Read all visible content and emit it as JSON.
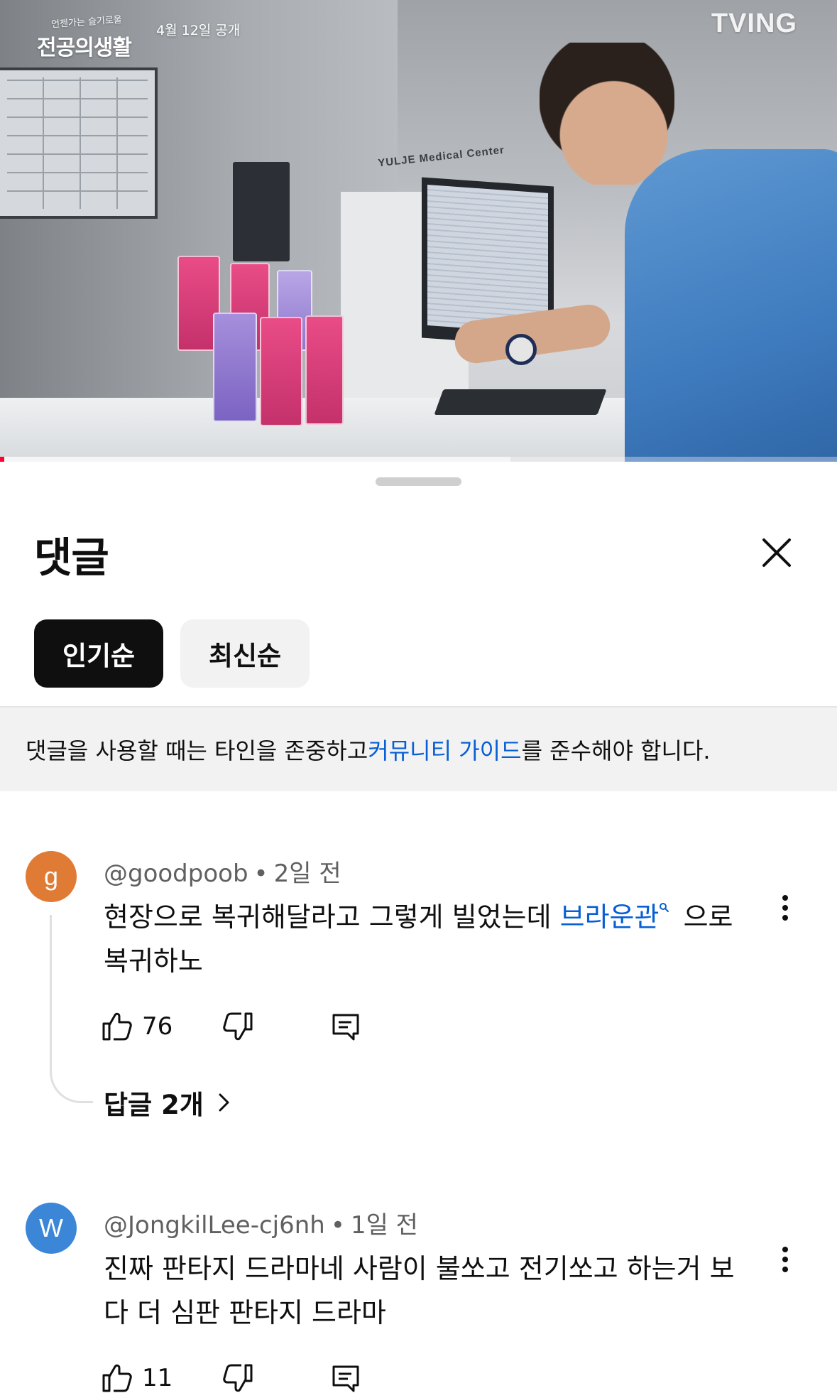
{
  "video": {
    "promo_tagline": "언젠가는 슬기로울",
    "promo_show_title": "전공의생활",
    "promo_release": "4월 12일 공개",
    "network_logo": "TVING",
    "clinic_sign": "YULJE Medical Center",
    "progress_played_fraction": 0.005,
    "progress_buffered_fraction": 0.61
  },
  "comments_panel": {
    "title": "댓글",
    "close_icon": "close-icon",
    "sort_chips": [
      {
        "label": "인기순",
        "selected": true
      },
      {
        "label": "최신순",
        "selected": false
      }
    ],
    "guideline": {
      "before": "댓글을 사용할 때는 타인을 존중하고 ",
      "link": "커뮤니티 가이드",
      "after": "를 준수해야 합니다."
    }
  },
  "comments": [
    {
      "avatar_letter": "g",
      "avatar_color": "#e07b36",
      "handle": "@goodpoob",
      "separator": "•",
      "time": "2일 전",
      "text_before": "현장으로 복귀해달라고 그렇게 빌었는데 ",
      "mention": "브라운관",
      "text_after": " 으로 복귀하노",
      "likes": "76",
      "replies_label": "답글 2개"
    },
    {
      "avatar_letter": "W",
      "avatar_color": "#3b86d6",
      "handle": "@JongkilLee-cj6nh",
      "separator": "•",
      "time": "1일 전",
      "text": "진짜 판타지 드라마네 사람이 불쏘고 전기쏘고 하는거 보다 더 심판 판타지 드라마",
      "likes": "11"
    }
  ],
  "colors": {
    "accent_link": "#065fd4",
    "progress_red": "#ff0033",
    "chip_active_bg": "#0f0f0f",
    "chip_inactive_bg": "#f2f2f2"
  }
}
